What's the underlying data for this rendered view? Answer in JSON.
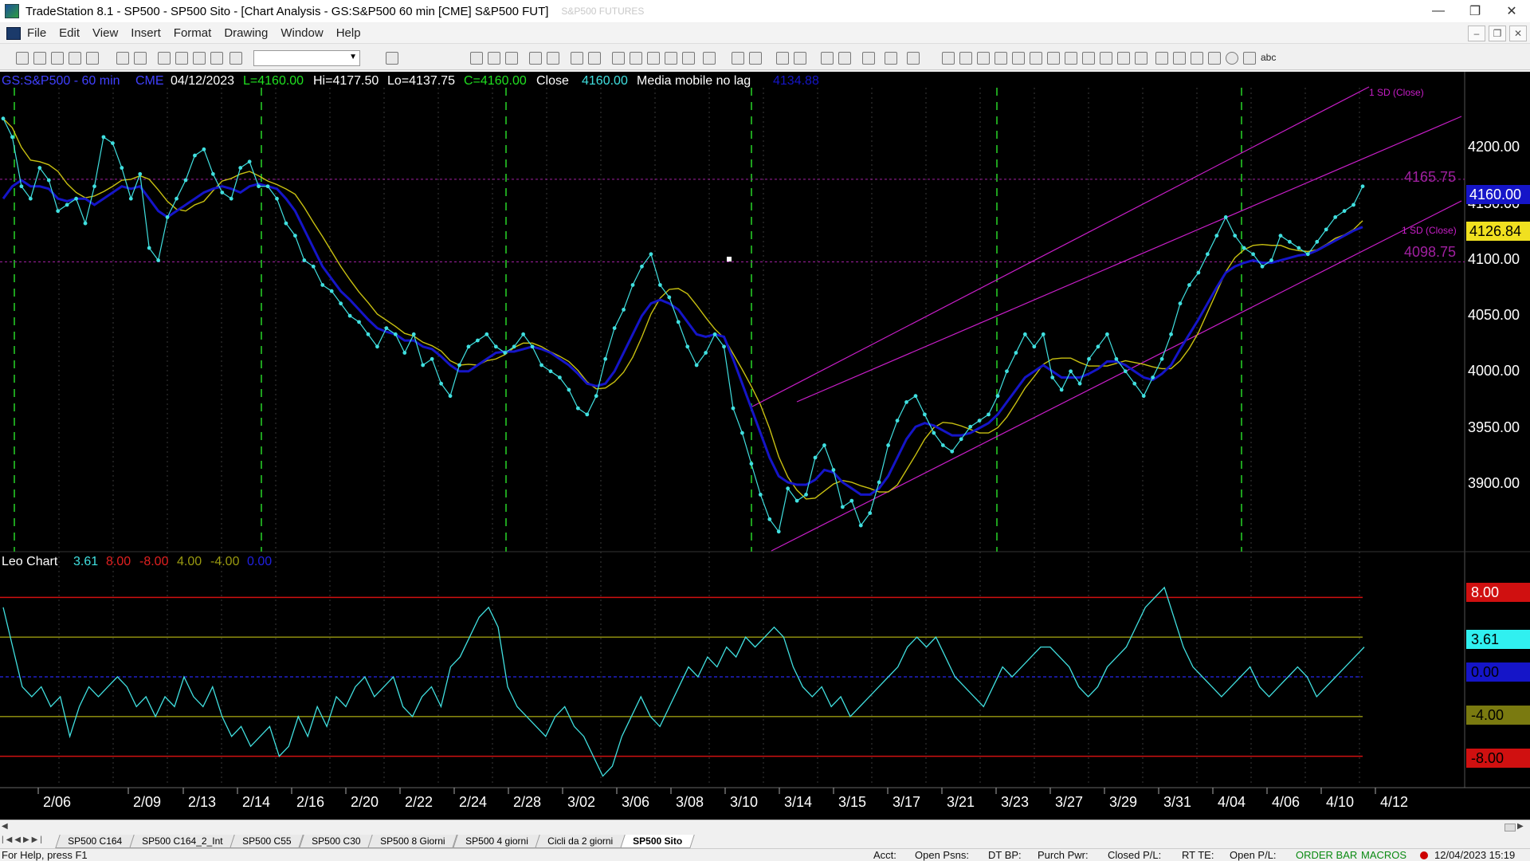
{
  "window": {
    "title": "TradeStation 8.1 - SP500 - SP500 Sito - [Chart Analysis - GS:S&P500  60 min  [CME] S&P500 FUT]",
    "faded_title": "S&P500 FUTURES"
  },
  "menu": [
    "File",
    "Edit",
    "View",
    "Insert",
    "Format",
    "Drawing",
    "Window",
    "Help"
  ],
  "header": {
    "symbol": "GS:S&P500 - 60 min",
    "exchange": "CME",
    "date": "04/12/2023",
    "last": "L=4160.00",
    "high": "Hi=4177.50",
    "low": "Lo=4137.75",
    "close_eq": "C=4160.00",
    "close_label": "Close",
    "close_value": "4160.00",
    "indicator_name": "Media mobile no lag",
    "indicator_value": "4134.88"
  },
  "oscillator_header": {
    "name": "Leo Chart",
    "values": [
      "3.61",
      "8.00",
      "-8.00",
      "4.00",
      "-4.00",
      "0.00"
    ]
  },
  "price_axis": {
    "ticks": [
      "4200.00",
      "4150.00",
      "4100.00",
      "4050.00",
      "4000.00",
      "3950.00",
      "3900.00"
    ],
    "tag_close": "4160.00",
    "tag_ma": "4126.84",
    "level_upper": "4165.75",
    "level_lower": "4098.75",
    "sd_label": "1 SD (Close)"
  },
  "osc_axis": {
    "tag_plus8": "8.00",
    "tag_value": "3.61",
    "tag_zero": "0.00",
    "tag_minus4": "-4.00",
    "tag_minus8": "-8.00"
  },
  "date_axis": [
    "2/06",
    "2/09",
    "2/13",
    "2/14",
    "2/16",
    "2/20",
    "2/22",
    "2/24",
    "2/28",
    "3/02",
    "3/06",
    "3/08",
    "3/10",
    "3/14",
    "3/15",
    "3/17",
    "3/21",
    "3/23",
    "3/27",
    "3/29",
    "3/31",
    "4/04",
    "4/06",
    "4/10",
    "4/12"
  ],
  "colors": {
    "close_line": "#40e0e0",
    "fast_ma": "#1515c8",
    "slow_ma": "#c8c010",
    "channel": "#c81ec8",
    "cycle_lines": "#1ea01e",
    "osc_upper": "#d01010",
    "osc_mid": "#9a9a10",
    "osc_zero": "#2020c8"
  },
  "chart_data": {
    "type": "line",
    "title": "GS:S&P500 - 60 min",
    "ylim": [
      3865,
      4240
    ],
    "series": [
      {
        "name": "Close",
        "values": [
          4215,
          4200,
          4160,
          4150,
          4175,
          4165,
          4140,
          4145,
          4150,
          4130,
          4160,
          4200,
          4195,
          4175,
          4150,
          4170,
          4110,
          4100,
          4135,
          4150,
          4165,
          4185,
          4190,
          4170,
          4155,
          4150,
          4175,
          4180,
          4160,
          4160,
          4150,
          4130,
          4120,
          4100,
          4095,
          4080,
          4075,
          4065,
          4055,
          4050,
          4040,
          4030,
          4045,
          4040,
          4025,
          4040,
          4015,
          4020,
          4000,
          3990,
          4015,
          4030,
          4035,
          4040,
          4030,
          4025,
          4030,
          4040,
          4030,
          4015,
          4010,
          4005,
          3995,
          3980,
          3975,
          3990,
          4020,
          4045,
          4060,
          4080,
          4095,
          4105,
          4080,
          4070,
          4050,
          4030,
          4015,
          4025,
          4040,
          4030,
          3980,
          3960,
          3935,
          3910,
          3890,
          3880,
          3915,
          3905,
          3910,
          3940,
          3950,
          3930,
          3900,
          3905,
          3885,
          3895,
          3920,
          3950,
          3970,
          3985,
          3990,
          3975,
          3960,
          3950,
          3945,
          3955,
          3965,
          3970,
          3975,
          3990,
          4010,
          4025,
          4040,
          4030,
          4040,
          4005,
          3995,
          4010,
          4000,
          4020,
          4030,
          4040,
          4020,
          4010,
          4000,
          3990,
          4005,
          4020,
          4040,
          4065,
          4080,
          4090,
          4105,
          4120,
          4135,
          4120,
          4110,
          4105,
          4095,
          4100,
          4120,
          4115,
          4110,
          4105,
          4115,
          4125,
          4135,
          4140,
          4145,
          4160
        ]
      },
      {
        "name": "Media mobile no lag",
        "values": [
          4150,
          4160,
          4165,
          4160,
          4160,
          4158,
          4150,
          4148,
          4150,
          4150,
          4145,
          4150,
          4155,
          4160,
          4158,
          4160,
          4150,
          4140,
          4135,
          4140,
          4145,
          4150,
          4155,
          4158,
          4160,
          4158,
          4155,
          4160,
          4162,
          4160,
          4158,
          4150,
          4140,
          4125,
          4110,
          4095,
          4085,
          4075,
          4068,
          4060,
          4052,
          4045,
          4042,
          4040,
          4035,
          4035,
          4030,
          4028,
          4022,
          4015,
          4010,
          4010,
          4015,
          4020,
          4025,
          4026,
          4026,
          4028,
          4030,
          4028,
          4025,
          4020,
          4015,
          4008,
          4000,
          3998,
          4000,
          4010,
          4025,
          4040,
          4055,
          4065,
          4068,
          4065,
          4060,
          4050,
          4040,
          4038,
          4040,
          4038,
          4020,
          4000,
          3980,
          3960,
          3940,
          3925,
          3920,
          3918,
          3918,
          3922,
          3930,
          3928,
          3920,
          3915,
          3910,
          3910,
          3915,
          3925,
          3940,
          3955,
          3965,
          3968,
          3966,
          3962,
          3958,
          3958,
          3960,
          3964,
          3968,
          3975,
          3985,
          3995,
          4005,
          4010,
          4015,
          4010,
          4005,
          4005,
          4005,
          4008,
          4012,
          4018,
          4018,
          4015,
          4010,
          4005,
          4003,
          4008,
          4015,
          4028,
          4040,
          4052,
          4065,
          4078,
          4090,
          4095,
          4098,
          4100,
          4098,
          4098,
          4100,
          4102,
          4104,
          4105,
          4108,
          4112,
          4116,
          4120,
          4124,
          4127
        ]
      },
      {
        "name": "Leo Chart",
        "values": [
          7,
          3,
          -1,
          -2,
          -1,
          -3,
          -2,
          -6,
          -3,
          -1,
          -2,
          -1,
          0,
          -1,
          -3,
          -2,
          -4,
          -2,
          -3,
          0,
          -2,
          -3,
          -1,
          -4,
          -6,
          -5,
          -7,
          -6,
          -5,
          -8,
          -7,
          -4,
          -6,
          -3,
          -5,
          -2,
          -3,
          -1,
          0,
          -2,
          -1,
          0,
          -3,
          -4,
          -2,
          -1,
          -3,
          1,
          2,
          4,
          6,
          7,
          5,
          -1,
          -3,
          -4,
          -5,
          -6,
          -4,
          -3,
          -5,
          -6,
          -8,
          -10,
          -9,
          -6,
          -4,
          -2,
          -4,
          -5,
          -3,
          -1,
          1,
          0,
          2,
          1,
          3,
          2,
          4,
          3,
          4,
          5,
          4,
          1,
          -1,
          -2,
          -1,
          -3,
          -2,
          -4,
          -3,
          -2,
          -1,
          0,
          1,
          3,
          4,
          3,
          4,
          2,
          0,
          -1,
          -2,
          -3,
          -1,
          1,
          0,
          1,
          2,
          3,
          3,
          2,
          1,
          -1,
          -2,
          -1,
          1,
          2,
          3,
          5,
          7,
          8,
          9,
          6,
          3,
          1,
          0,
          -1,
          -2,
          -1,
          0,
          1,
          -1,
          -2,
          -1,
          0,
          1,
          0,
          -2,
          -1,
          0,
          1,
          2,
          3
        ]
      }
    ]
  }
}
